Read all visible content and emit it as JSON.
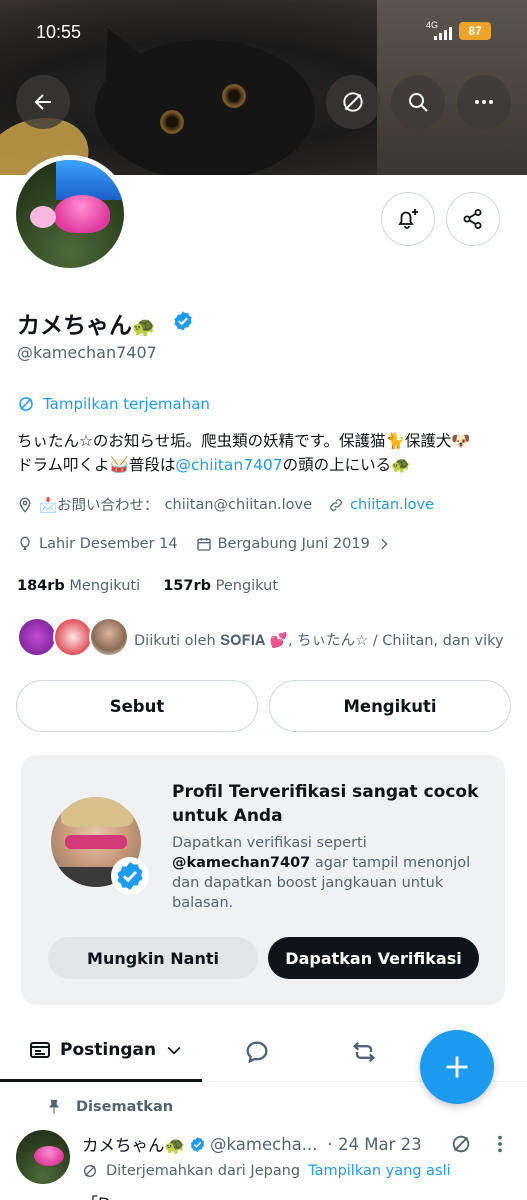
{
  "status_bar": {
    "time": "10:55",
    "network": "4G",
    "battery": "87"
  },
  "header": {
    "back_icon": "arrow-left-icon",
    "translate_icon": "translate-icon",
    "search_icon": "search-icon",
    "more_icon": "more-horizontal-icon"
  },
  "profile": {
    "display_name": "カメちゃん",
    "name_emoji": "🐢",
    "handle": "@kamechan7407",
    "translate_label": "Tampilkan terjemahan",
    "bio_line1": "ちぃたん☆のお知らせ垢。爬虫類の妖精です。保護猫🐈保護犬🐶",
    "bio_line2_pre": "ドラム叩くよ🥁普段は",
    "bio_link": "@chiitan7407",
    "bio_line2_post": "の頭の上にいる🐢",
    "contact_prefix": "📩お問い合わせ：",
    "contact_email": "chiitan@chiitan.love",
    "website": "chiitan.love",
    "birthday": "Lahir Desember 14",
    "joined": "Bergabung Juni 2019",
    "following_count": "184rb",
    "following_label": "Mengikuti",
    "followers_count": "157rb",
    "followers_label": "Pengikut",
    "followed_by_text": "Diikuti oleh 𝐒𝐎𝐅𝐈𝐀 💕, ちぃたん☆ / Chiitan, dan viky"
  },
  "actions": {
    "mention_label": "Sebut",
    "following_label": "Mengikuti"
  },
  "promo": {
    "title": "Profil Terverifikasi sangat cocok untuk Anda",
    "desc_pre": "Dapatkan verifikasi seperti",
    "desc_handle": "@kamechan7407",
    "desc_post": "agar tampil menonjol dan dapatkan boost jangkauan untuk balasan.",
    "later_label": "Mungkin Nanti",
    "verify_label": "Dapatkan Verifikasi"
  },
  "tabs": {
    "posts_label": "Postingan"
  },
  "pinned": {
    "label": "Disematkan",
    "name": "カメちゃん🐢",
    "handle": "@kamecha...",
    "date": "· 24 Mar 23",
    "translated_label": "Diterjemahkan dari Jepang",
    "show_original": "Tampilkan yang asli",
    "text_start": "「D..."
  },
  "colors": {
    "accent": "#1d9bf0",
    "text": "#0f1419",
    "muted": "#536471",
    "battery": "#f0a32b"
  }
}
